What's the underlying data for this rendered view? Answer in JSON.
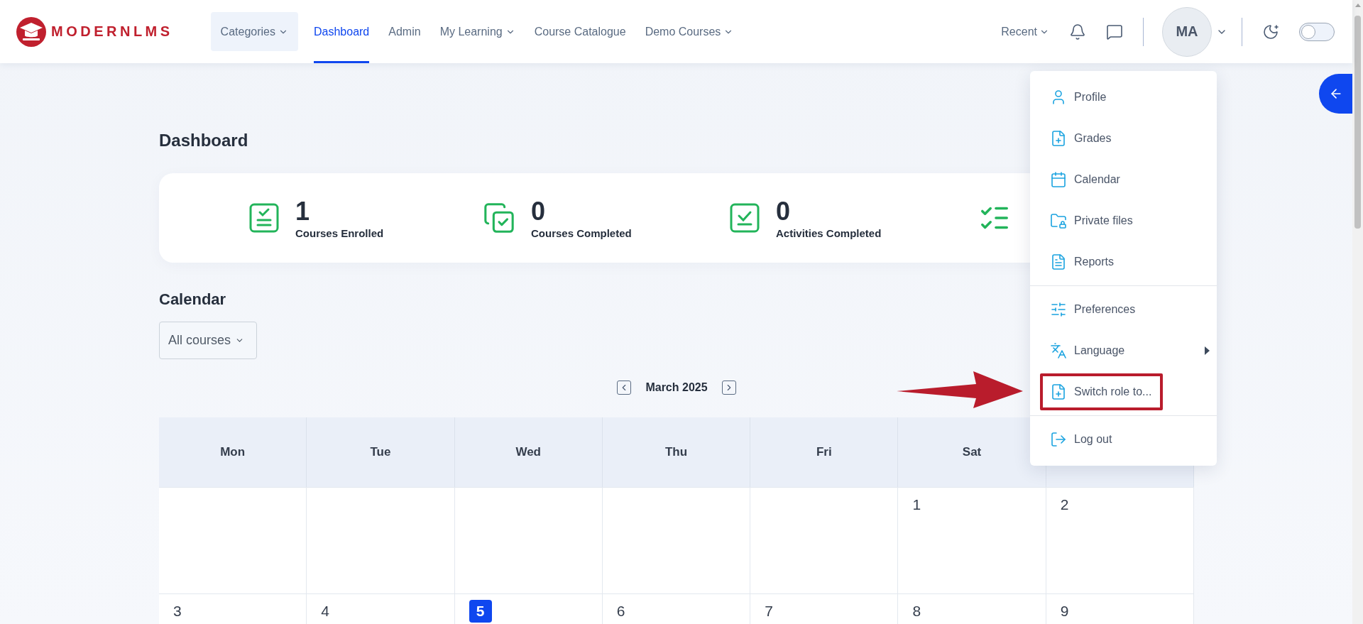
{
  "header": {
    "logo": {
      "text": "MODERNLMS"
    },
    "nav": [
      {
        "label": "Categories",
        "kind": "pill",
        "dropdown": true,
        "selected": false
      },
      {
        "label": "Dashboard",
        "kind": "link",
        "dropdown": false,
        "selected": true
      },
      {
        "label": "Admin",
        "kind": "link",
        "dropdown": false,
        "selected": false
      },
      {
        "label": "My Learning",
        "kind": "link",
        "dropdown": true,
        "selected": false
      },
      {
        "label": "Course Catalogue",
        "kind": "link",
        "dropdown": false,
        "selected": false
      },
      {
        "label": "Demo Courses",
        "kind": "link",
        "dropdown": true,
        "selected": false
      }
    ],
    "recent": {
      "label": "Recent"
    },
    "user": {
      "initials": "MA"
    },
    "dark_mode": {
      "on": false
    }
  },
  "page": {
    "title": "Dashboard"
  },
  "stats": [
    {
      "kind": "enrolled",
      "value": "1",
      "label": "Courses Enrolled"
    },
    {
      "kind": "courses-completed",
      "value": "0",
      "label": "Courses Completed"
    },
    {
      "kind": "activities-completed",
      "value": "0",
      "label": "Activities Completed"
    },
    {
      "kind": "list"
    }
  ],
  "calendar": {
    "title": "Calendar",
    "filter": {
      "value": "All courses"
    },
    "month": "March 2025",
    "weekdays": [
      "Mon",
      "Tue",
      "Wed",
      "Thu",
      "Fri",
      "Sat"
    ],
    "weeks": [
      [
        {
          "day": "1",
          "today": false
        },
        {
          "day": "2",
          "today": false
        }
      ],
      [
        {
          "day": "3",
          "today": false
        },
        {
          "day": "4",
          "today": false
        },
        {
          "day": "5",
          "today": true
        },
        {
          "day": "6",
          "today": false
        },
        {
          "day": "7",
          "today": false
        },
        {
          "day": "8",
          "today": false
        },
        {
          "day": "9",
          "today": false
        }
      ]
    ]
  },
  "user_menu": {
    "groups": [
      [
        {
          "kind": "profile",
          "label": "Profile",
          "submenu": false,
          "highlighted": false
        },
        {
          "kind": "grades",
          "label": "Grades",
          "submenu": false,
          "highlighted": false
        },
        {
          "kind": "calendar",
          "label": "Calendar",
          "submenu": false,
          "highlighted": false
        },
        {
          "kind": "files",
          "label": "Private files",
          "submenu": false,
          "highlighted": false
        },
        {
          "kind": "reports",
          "label": "Reports",
          "submenu": false,
          "highlighted": false
        }
      ],
      [
        {
          "kind": "preferences",
          "label": "Preferences",
          "submenu": false,
          "highlighted": false
        },
        {
          "kind": "language",
          "label": "Language",
          "submenu": true,
          "highlighted": false
        },
        {
          "kind": "switch-role",
          "label": "Switch role to...",
          "submenu": false,
          "highlighted": true
        }
      ],
      [
        {
          "kind": "logout",
          "label": "Log out",
          "submenu": false,
          "highlighted": false
        }
      ]
    ]
  }
}
